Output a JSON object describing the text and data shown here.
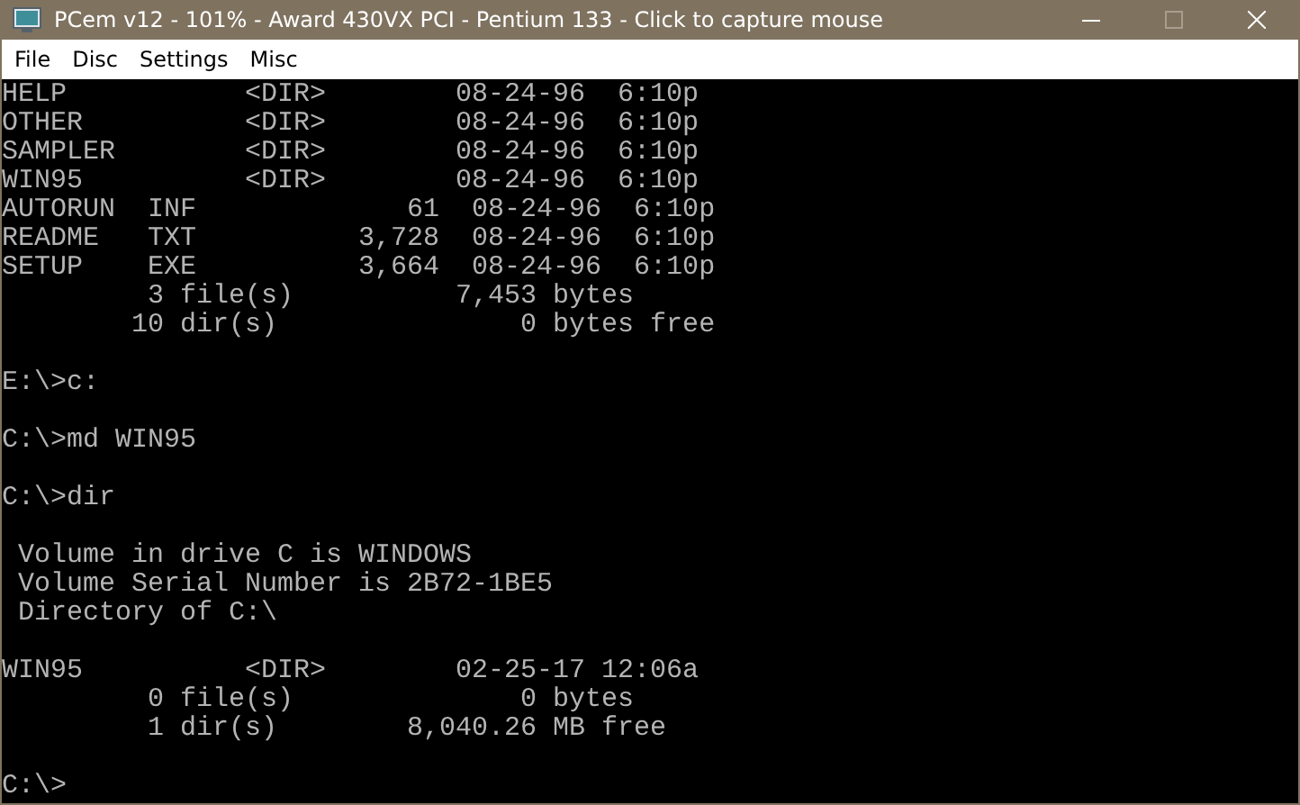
{
  "window": {
    "title": "PCem v12 - 101% - Award 430VX PCI - Pentium 133 - Click to capture mouse"
  },
  "menu": [
    "File",
    "Disc",
    "Settings",
    "Misc"
  ],
  "console": {
    "blocks": [
      [
        "HELP           <DIR>        08-24-96  6:10p",
        "OTHER          <DIR>        08-24-96  6:10p",
        "SAMPLER        <DIR>        08-24-96  6:10p",
        "WIN95          <DIR>        08-24-96  6:10p",
        "AUTORUN  INF             61  08-24-96  6:10p",
        "README   TXT          3,728  08-24-96  6:10p",
        "SETUP    EXE          3,664  08-24-96  6:10p",
        "         3 file(s)          7,453 bytes",
        "        10 dir(s)               0 bytes free"
      ],
      [
        "E:\\>c:"
      ],
      [
        "C:\\>md WIN95"
      ],
      [
        "C:\\>dir"
      ],
      [
        " Volume in drive C is WINDOWS",
        " Volume Serial Number is 2B72-1BE5",
        " Directory of C:\\"
      ],
      [
        "WIN95          <DIR>        02-25-17 12:06a",
        "         0 file(s)              0 bytes",
        "         1 dir(s)        8,040.26 MB free"
      ],
      [
        "C:\\>"
      ]
    ]
  }
}
